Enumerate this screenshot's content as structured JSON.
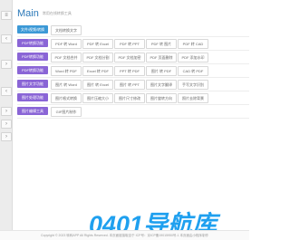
{
  "sidebar": {
    "buttons": [
      "≡",
      "‹",
      "›",
      "‹",
      "›",
      "›",
      "›"
    ]
  },
  "header": {
    "title": "Main",
    "subtitle": "常用在线转换工具"
  },
  "rows": [
    {
      "tag": "文件/视频/转换",
      "tools": [
        "文档转换文字"
      ]
    },
    {
      "tag": "PDF转换功能",
      "tools": [
        "PDF 转 Word",
        "PDF 转 Excel",
        "PDF 转 PPT",
        "PDF 转 图片",
        "PDF 转 CAD"
      ]
    },
    {
      "tag": "PDF转换功能",
      "tools": [
        "PDF 文档合并",
        "PDF 文档分割",
        "PDF 文档加密",
        "PDF 页面删除",
        "PDF 添加水印"
      ]
    },
    {
      "tag": "PDF转换功能",
      "tools": [
        "Word 转 PDF",
        "Excel 转 PDF",
        "PPT 转 PDF",
        "图片 转 PDF",
        "CAD 转 PDF"
      ]
    },
    {
      "tag": "图片文字功能",
      "tools": [
        "图片 转 Word",
        "图片 转 Excel",
        "图片 转 PPT",
        "图片文字翻译",
        "手写文字识别"
      ]
    },
    {
      "tag": "图片处理功能",
      "tools": [
        "图片格式转换",
        "图片压缩大小",
        "图片尺寸修改",
        "图片旋转方向",
        "照片去除背景"
      ]
    },
    {
      "tag": "图片编辑工具",
      "tools": [
        "GIF图片制作"
      ]
    }
  ],
  "watermark": "0401导航库",
  "footer": {
    "text": "Copyright © 2023 转转APP All Rights Reserved. 本页面链接取自于 ICP号：京ICP备19015950号-1 本页面由小程序制作"
  }
}
